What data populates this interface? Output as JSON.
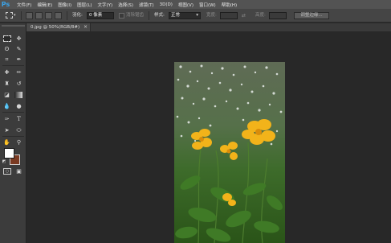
{
  "app": {
    "logo": "Ps"
  },
  "menu": [
    "文件(F)",
    "编辑(E)",
    "图像(I)",
    "图层(L)",
    "文字(Y)",
    "选择(S)",
    "滤镜(T)",
    "3D(D)",
    "视图(V)",
    "窗口(W)",
    "帮助(H)"
  ],
  "options": {
    "feather_label": "羽化:",
    "feather_value": "0 像素",
    "antialias_label": "消除锯齿",
    "style_label": "样式:",
    "style_value": "正常",
    "width_label": "宽度:",
    "height_label": "高度:",
    "refine_button": "调整边缘..."
  },
  "document_tab": {
    "title": "0.jpg @ 50%(RGB/8#)",
    "close": "×"
  },
  "colors": {
    "foreground": "#ffffff",
    "background": "#7a3a22",
    "accent": "#3ba3e8"
  }
}
